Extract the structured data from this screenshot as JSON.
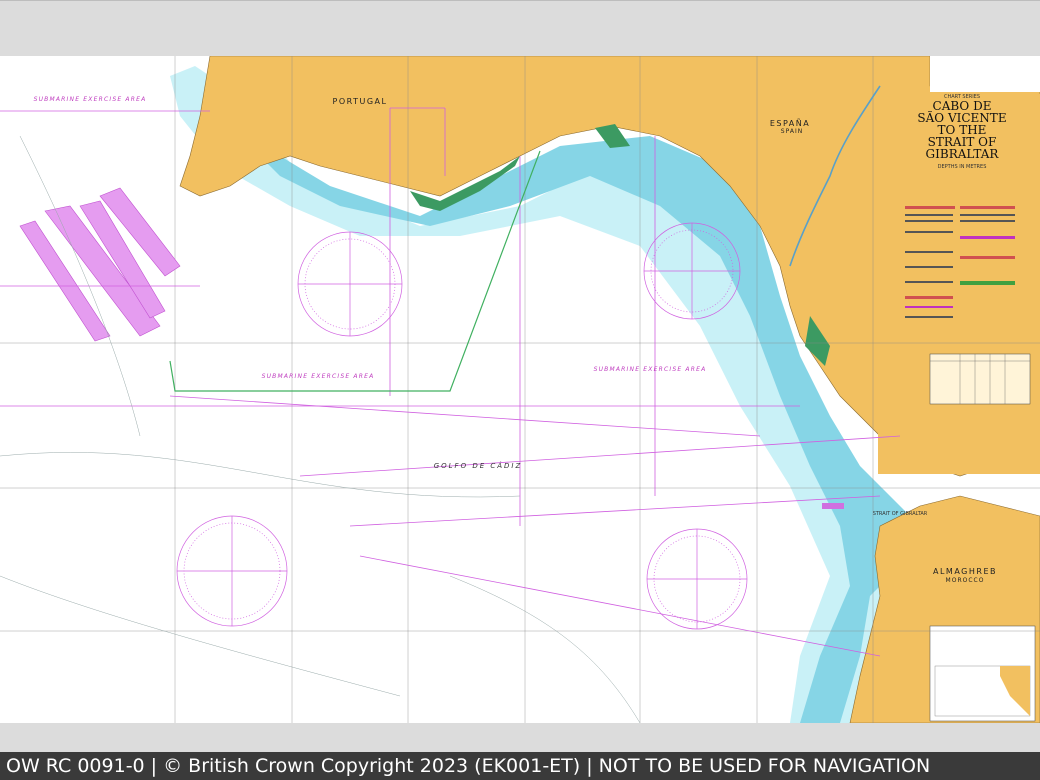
{
  "chart": {
    "title_lines": [
      "CABO DE",
      "SÃO VICENTE",
      "TO THE",
      "STRAIT OF",
      "GIBRALTAR"
    ],
    "series_label": "CHART SERIES",
    "depth_note": "DEPTHS IN METRES"
  },
  "labels": {
    "portugal": "PORTUGAL",
    "espana": "ESPAÑA",
    "spain": "SPAIN",
    "al_maghreb": "ALMAGHREB",
    "morocco": "MOROCCO",
    "golfo": "GOLFO DE CÁDIZ",
    "sub_area_1": "SUBMARINE EXERCISE AREA",
    "sub_area_2": "SUBMARINE EXERCISE AREA",
    "sub_area_3": "SUBMARINE EXERCISE AREA",
    "strait": "STRAIT OF GIBRALTAR"
  },
  "footer": {
    "text": "OW RC 0091-0 | © British Crown Copyright 2023 (EK001-ET) | NOT TO BE USED FOR NAVIGATION"
  },
  "colors": {
    "land": "#f2c060",
    "shallow": "#7fd2e0",
    "mid": "#b9ecf4",
    "deep": "#ffffff",
    "magenta": "#d060e0",
    "green_coast": "#2e8b57"
  }
}
